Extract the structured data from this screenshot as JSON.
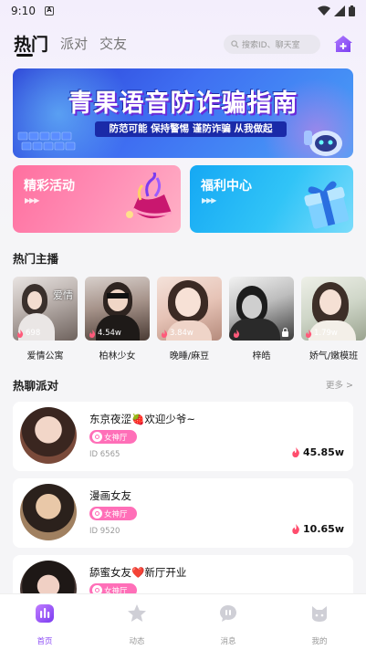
{
  "status_bar": {
    "time": "9:10",
    "notification_letter": "A"
  },
  "top_nav": {
    "tabs": [
      {
        "label": "热门",
        "active": true
      },
      {
        "label": "派对",
        "active": false
      },
      {
        "label": "交友",
        "active": false
      }
    ],
    "search_placeholder": "搜索ID、聊天室"
  },
  "banner": {
    "title": "青果语音防诈骗指南",
    "subtitle": "防范可能 保持警惕 谨防诈骗 从我做起"
  },
  "feature_cards": [
    {
      "label": "精彩活动",
      "arrows": "▶▶▶"
    },
    {
      "label": "福利中心",
      "arrows": "▶▶▶"
    }
  ],
  "hot_anchors": {
    "title": "热门主播",
    "items": [
      {
        "name": "爱情公寓",
        "count": "698"
      },
      {
        "name": "柏林少女",
        "count": "4.54w"
      },
      {
        "name": "晚睡/麻豆",
        "count": "3.84w"
      },
      {
        "name": "梓皓",
        "count": ""
      },
      {
        "name": "娇气/嫩模班",
        "count": "1.79w"
      }
    ]
  },
  "hot_parties": {
    "title": "热聊派对",
    "more_label": "更多 >",
    "items": [
      {
        "title": "东京夜涩🍓欢迎少爷~",
        "tag": "女神厅",
        "id": "ID 6565",
        "heat": "45.85w"
      },
      {
        "title": "漫画女友",
        "tag": "女神厅",
        "id": "ID 9520",
        "heat": "10.65w"
      },
      {
        "title": "舔蜜女友❤️新厅开业",
        "tag": "女神厅",
        "id": "",
        "heat": ""
      }
    ]
  },
  "bottom_tabs": [
    {
      "label": "首页",
      "icon": "home-bars-icon",
      "active": true
    },
    {
      "label": "动态",
      "icon": "star-icon",
      "active": false
    },
    {
      "label": "消息",
      "icon": "chat-bubble-icon",
      "active": false
    },
    {
      "label": "我的",
      "icon": "cat-face-icon",
      "active": false
    }
  ],
  "colors": {
    "accent": "#8d4cf5",
    "tag_pink": "#ff6fb8",
    "heat_red": "#ff4d6d"
  }
}
